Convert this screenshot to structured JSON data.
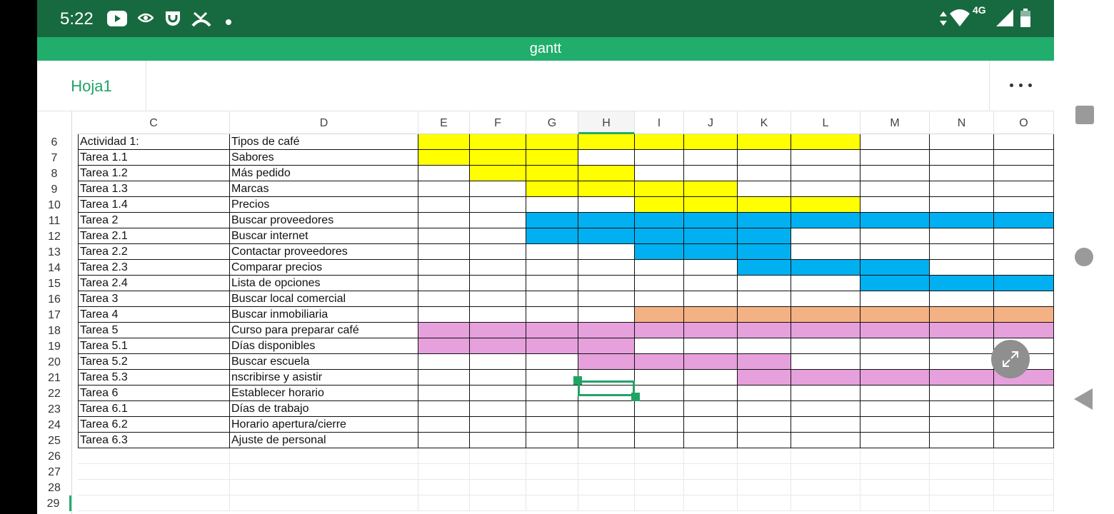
{
  "status_bar": {
    "time": "5:22",
    "icons": [
      "youtube-icon",
      "eye-icon",
      "shopping-bag-icon",
      "missed-call-icon",
      "dot-icon"
    ],
    "right_icons": [
      "data-arrows-icon",
      "wifi-icon",
      "network-4g-icon",
      "signal-icon",
      "battery-icon"
    ],
    "network": "4G"
  },
  "document": {
    "title": "gantt"
  },
  "tabs": {
    "active_sheet": "Hoja1",
    "more_label": "More options"
  },
  "columns": [
    "C",
    "D",
    "E",
    "F",
    "G",
    "H",
    "I",
    "J",
    "K",
    "L",
    "M",
    "N",
    "O"
  ],
  "active_column": "H",
  "rows": [
    {
      "num": "6",
      "c": "Actividad 1:",
      "d": "Tipos de café"
    },
    {
      "num": "7",
      "c": "Tarea 1.1",
      "d": "Sabores"
    },
    {
      "num": "8",
      "c": "Tarea 1.2",
      "d": "Más pedido"
    },
    {
      "num": "9",
      "c": "Tarea 1.3",
      "d": " Marcas"
    },
    {
      "num": "10",
      "c": "Tarea 1.4",
      "d": "Precios"
    },
    {
      "num": "11",
      "c": "Tarea 2",
      "d": "Buscar proveedores"
    },
    {
      "num": "12",
      "c": "Tarea 2.1",
      "d": "Buscar  internet"
    },
    {
      "num": "13",
      "c": "Tarea 2.2",
      "d": "Contactar  proveedores"
    },
    {
      "num": "14",
      "c": "Tarea 2.3",
      "d": "Comparar precios"
    },
    {
      "num": "15",
      "c": "Tarea 2.4",
      "d": "Lista de opciones"
    },
    {
      "num": "16",
      "c": "Tarea 3",
      "d": "Buscar local comercial"
    },
    {
      "num": "17",
      "c": "Tarea 4",
      "d": "Buscar inmobiliaria"
    },
    {
      "num": "18",
      "c": "Tarea 5",
      "d": "Curso para preparar café"
    },
    {
      "num": "19",
      "c": "Tarea 5.1",
      "d": "Días disponibles"
    },
    {
      "num": "20",
      "c": "Tarea 5.2",
      "d": "Buscar escuela"
    },
    {
      "num": "21",
      "c": "Tarea 5.3",
      "d": "nscribirse y asistir"
    },
    {
      "num": "22",
      "c": "Tarea 6",
      "d": "Establecer horario"
    },
    {
      "num": "23",
      "c": "Tarea 6.1",
      "d": "Días de trabajo"
    },
    {
      "num": "24",
      "c": "Tarea 6.2",
      "d": "Horario apertura/cierre"
    },
    {
      "num": "25",
      "c": "Tarea 6.3",
      "d": "Ajuste de personal"
    },
    {
      "num": "26",
      "c": "",
      "d": ""
    },
    {
      "num": "27",
      "c": "",
      "d": ""
    },
    {
      "num": "28",
      "c": "",
      "d": ""
    },
    {
      "num": "29",
      "c": "",
      "d": ""
    }
  ],
  "active_row": "29",
  "colors": {
    "yellow": "#ffff00",
    "blue": "#00b0f0",
    "orange": "#f4b183",
    "pink": "#e6a0dc",
    "accent": "#21ad6c",
    "status_bar": "#176a3f"
  },
  "gantt_bars": [
    {
      "row": "6",
      "from": "E",
      "to": "L",
      "color": "yellow"
    },
    {
      "row": "7",
      "from": "E",
      "to": "G",
      "color": "yellow"
    },
    {
      "row": "8",
      "from": "F",
      "to": "H",
      "color": "yellow"
    },
    {
      "row": "9",
      "from": "G",
      "to": "J",
      "color": "yellow"
    },
    {
      "row": "10",
      "from": "I",
      "to": "L",
      "color": "yellow"
    },
    {
      "row": "11",
      "from": "G",
      "to": "O",
      "color": "blue"
    },
    {
      "row": "12",
      "from": "G",
      "to": "K",
      "color": "blue"
    },
    {
      "row": "13",
      "from": "I",
      "to": "K",
      "color": "blue"
    },
    {
      "row": "14",
      "from": "K",
      "to": "M",
      "color": "blue"
    },
    {
      "row": "15",
      "from": "M",
      "to": "O",
      "color": "blue"
    },
    {
      "row": "17",
      "from": "I",
      "to": "O",
      "color": "orange"
    },
    {
      "row": "18",
      "from": "E",
      "to": "O",
      "color": "pink"
    },
    {
      "row": "19",
      "from": "E",
      "to": "H",
      "color": "pink"
    },
    {
      "row": "20",
      "from": "H",
      "to": "K",
      "color": "pink"
    },
    {
      "row": "21",
      "from": "K",
      "to": "O",
      "color": "pink"
    }
  ],
  "nav": [
    "recents-square-icon",
    "home-circle-icon",
    "back-triangle-icon"
  ],
  "fullscreen_icon": "expand-arrows-icon"
}
